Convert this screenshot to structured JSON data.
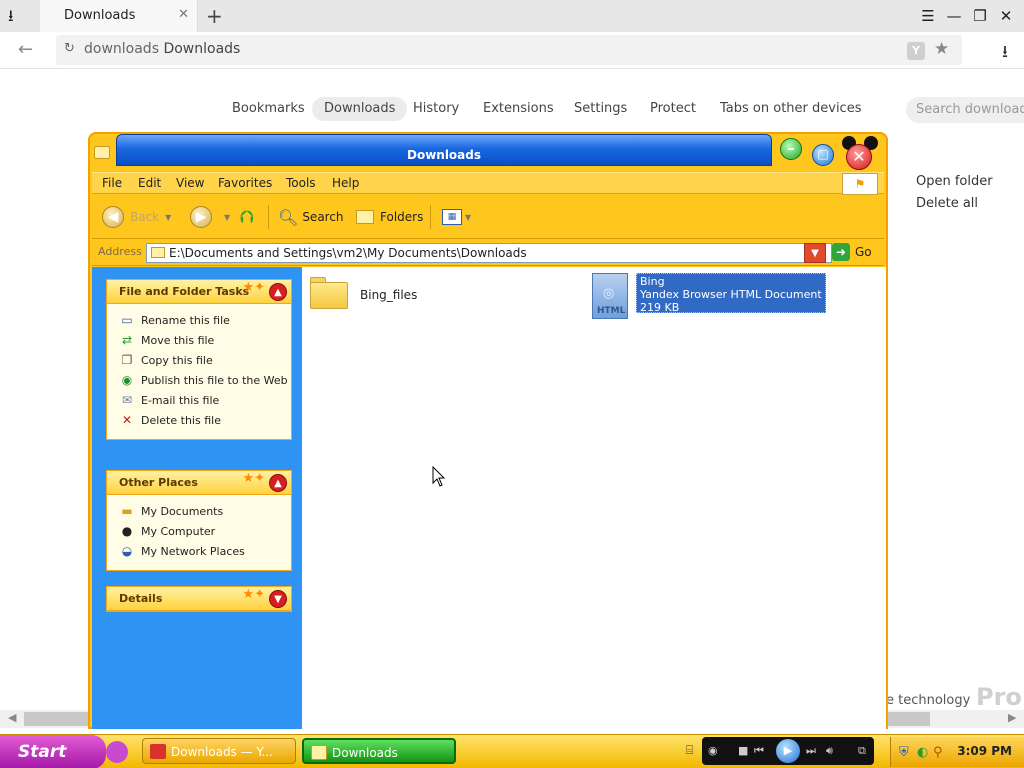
{
  "browser": {
    "tab_title": "Downloads",
    "address_url": "downloads",
    "address_title": "Downloads",
    "nav": [
      "Bookmarks",
      "Downloads",
      "History",
      "Extensions",
      "Settings",
      "Protect",
      "Tabs on other devices"
    ],
    "active_nav": "Downloads",
    "search_placeholder": "Search downloads",
    "open_folder": "Open folder",
    "delete_all": "Delete all",
    "bg_text_technology": "e technology",
    "bg_text_pro": "Pro"
  },
  "explorer": {
    "title": "Downloads",
    "menu": [
      "File",
      "Edit",
      "View",
      "Favorites",
      "Tools",
      "Help"
    ],
    "toolbar": {
      "back": "Back",
      "search": "Search",
      "folders": "Folders"
    },
    "address_label": "Address",
    "address_path": "E:\\Documents and Settings\\vm2\\My Documents\\Downloads",
    "go": "Go",
    "file_tasks": {
      "title": "File and Folder Tasks",
      "items": [
        "Rename this file",
        "Move this file",
        "Copy this file",
        "Publish this file to the Web",
        "E-mail this file",
        "Delete this file"
      ]
    },
    "other_places": {
      "title": "Other Places",
      "items": [
        "My Documents",
        "My Computer",
        "My Network Places"
      ]
    },
    "details": {
      "title": "Details"
    },
    "files": [
      {
        "name": "Bing_files",
        "type": "folder"
      },
      {
        "name": "Bing",
        "type_label": "Yandex Browser HTML Document",
        "size": "219 KB",
        "icon_tag": "HTML",
        "selected": true
      }
    ]
  },
  "taskbar": {
    "start_label": "Start",
    "tasks": [
      "Downloads — Y...",
      "Downloads"
    ],
    "clock": "3:09 PM"
  }
}
